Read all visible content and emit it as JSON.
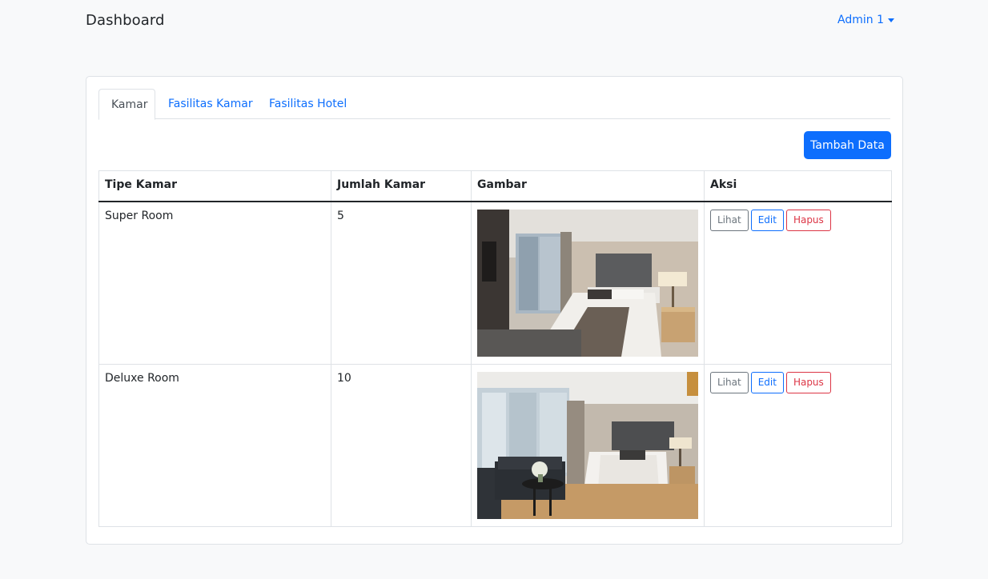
{
  "navbar": {
    "brand": "Dashboard",
    "user": "Admin 1",
    "user_icon": "caret-down-icon"
  },
  "tabs": [
    {
      "label": "Kamar",
      "active": true
    },
    {
      "label": "Fasilitas Kamar",
      "active": false
    },
    {
      "label": "Fasilitas Hotel",
      "active": false
    }
  ],
  "add_button": "Tambah Data",
  "table": {
    "headers": [
      "Tipe Kamar",
      "Jumlah Kamar",
      "Gambar",
      "Aksi"
    ],
    "rows": [
      {
        "tipe": "Super Room",
        "jumlah": "5",
        "image": "hotel-room-photo"
      },
      {
        "tipe": "Deluxe Room",
        "jumlah": "10",
        "image": "hotel-room-with-sofa-photo"
      }
    ],
    "actions": {
      "view": "Lihat",
      "edit": "Edit",
      "delete": "Hapus"
    }
  },
  "colors": {
    "primary": "#0d6efd",
    "danger": "#dc3545",
    "secondary": "#6c757d",
    "background": "#f8f9fa"
  }
}
